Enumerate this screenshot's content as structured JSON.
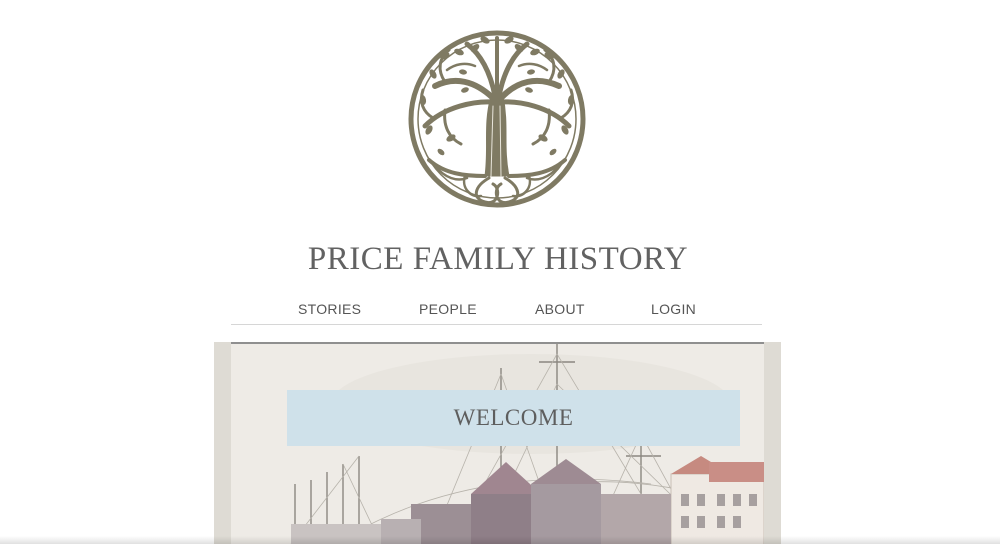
{
  "site": {
    "title": "PRICE FAMILY HISTORY",
    "logo_icon": "tree-of-life-icon",
    "logo_color": "#7f7a63"
  },
  "nav": {
    "items": [
      {
        "label": "STORIES"
      },
      {
        "label": "PEOPLE"
      },
      {
        "label": "ABOUT"
      },
      {
        "label": "LOGIN"
      }
    ]
  },
  "hero": {
    "image_icon": "harbor-sailing-ships-painting",
    "welcome_label": "WELCOME",
    "welcome_bg": "#cfe1ea"
  }
}
